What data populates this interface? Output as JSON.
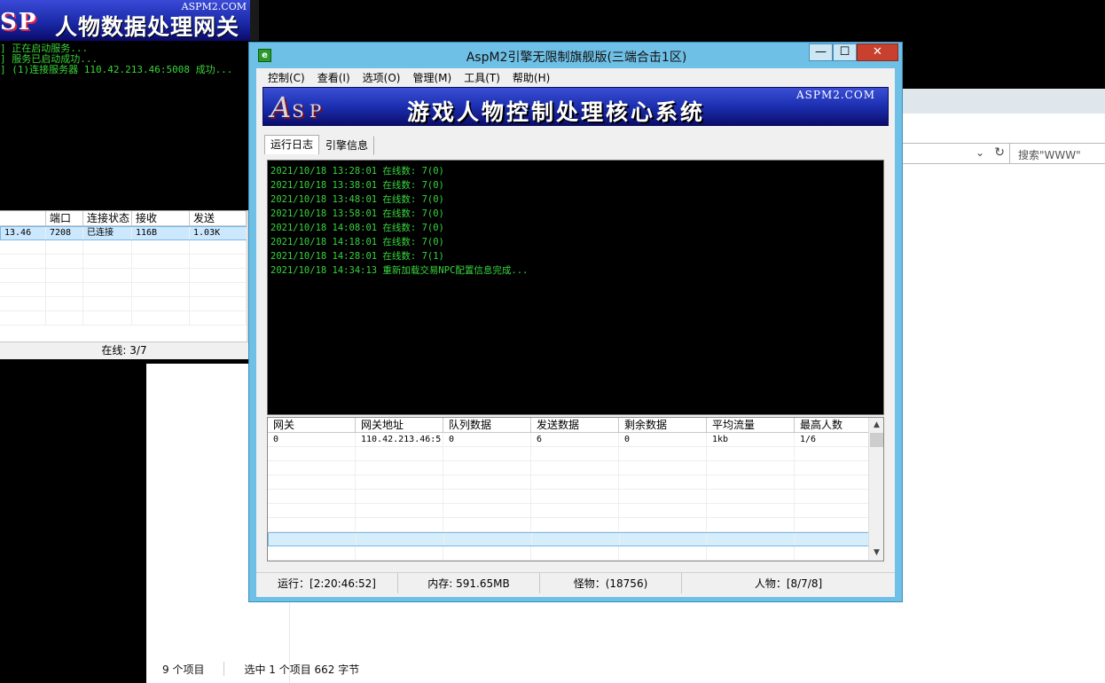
{
  "explorer": {
    "search_placeholder": "搜索\"WWW\"",
    "status": {
      "item_count": "9 个项目",
      "selection": "选中 1 个项目  662 字节"
    }
  },
  "gate": {
    "banner": {
      "asp": "SP",
      "title": "人物数据处理网关",
      "domain": "ASPM2.COM"
    },
    "log": [
      "] 正在启动服务...",
      "] 服务已启动成功...",
      "] (1)连接服务器 110.42.213.46:5008 成功..."
    ],
    "columns": [
      "",
      "端口",
      "连接状态",
      "接收",
      "发送"
    ],
    "rows": [
      {
        "addr": "13.46",
        "port": "7208",
        "state": "已连接",
        "recv": "116B",
        "send": "1.03K"
      }
    ],
    "online": "在线: 3/7"
  },
  "main": {
    "title": "AspM2引擎无限制旗舰版(三端合击1区)",
    "window_controls": {
      "minimize": "—",
      "maximize": "☐",
      "close": "✕"
    },
    "menu": [
      "控制(C)",
      "查看(I)",
      "选项(O)",
      "管理(M)",
      "工具(T)",
      "帮助(H)"
    ],
    "banner": {
      "asp": "A",
      "asp_rest": "SP",
      "title": "游戏人物控制处理核心系统",
      "domain": "ASPM2.COM"
    },
    "tabs": [
      "运行日志",
      "引擎信息"
    ],
    "active_tab": "运行日志",
    "console_lines": [
      "2021/10/18 13:28:01 在线数: 7(0)",
      "2021/10/18 13:38:01 在线数: 7(0)",
      "2021/10/18 13:48:01 在线数: 7(0)",
      "2021/10/18 13:58:01 在线数: 7(0)",
      "2021/10/18 14:08:01 在线数: 7(0)",
      "2021/10/18 14:18:01 在线数: 7(0)",
      "2021/10/18 14:28:01 在线数: 7(1)",
      "2021/10/18 14:34:13 重新加载交易NPC配置信息完成..."
    ],
    "grid_columns": [
      "网关",
      "网关地址",
      "队列数据",
      "发送数据",
      "剩余数据",
      "平均流量",
      "最高人数"
    ],
    "grid_rows": [
      [
        "0",
        "110.42.213.46:5",
        "0",
        "6",
        "0",
        "1kb",
        "1/6"
      ]
    ],
    "status": {
      "run": "运行：[2:20:46:52]",
      "memory": "内存: 591.65MB",
      "monsters": "怪物：(18756)",
      "players": "人物：[8/7/8]"
    }
  },
  "colors": {
    "console_text": "#39d43e",
    "window_frame": "#6fc0e6",
    "close_button": "#c7412e",
    "banner_blue": "#1c2fb0"
  }
}
